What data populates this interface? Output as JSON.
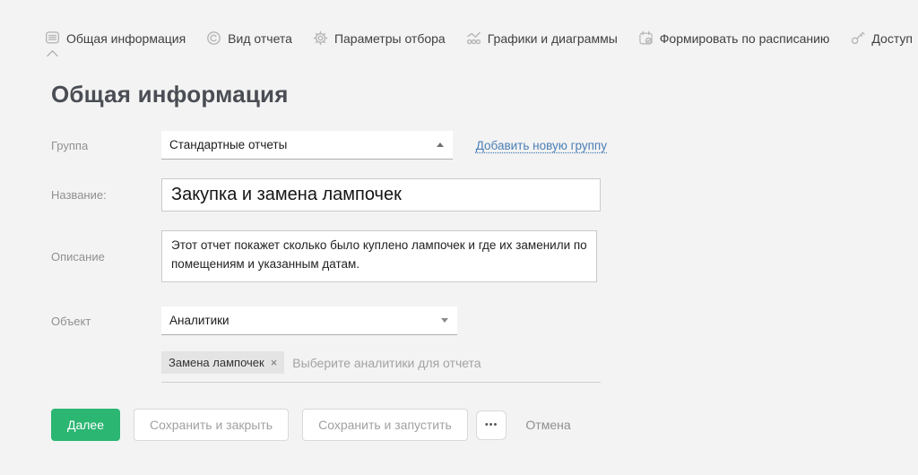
{
  "tabs": [
    {
      "label": "Общая информация",
      "icon": "document-lines-icon",
      "active": true
    },
    {
      "label": "Вид отчета",
      "icon": "report-view-icon",
      "active": false
    },
    {
      "label": "Параметры отбора",
      "icon": "gear-icon",
      "active": false
    },
    {
      "label": "Графики и диаграммы",
      "icon": "chart-icon",
      "active": false
    },
    {
      "label": "Формировать по расписанию",
      "icon": "schedule-calendar-icon",
      "active": false
    },
    {
      "label": "Доступ",
      "icon": "key-icon",
      "active": false
    }
  ],
  "heading": "Общая информация",
  "form": {
    "group": {
      "label": "Группа",
      "value": "Стандартные отчеты",
      "add_link": "Добавить новую группу"
    },
    "name": {
      "label": "Название:",
      "value": "Закупка и замена лампочек"
    },
    "description": {
      "label": "Описание",
      "value": "Этот отчет покажет сколько было куплено лампочек и где их заменили по помещениям и указанным датам."
    },
    "object": {
      "label": "Объект",
      "value": "Аналитики"
    },
    "analytics": {
      "tag": "Замена лампочек",
      "remove_icon": "×",
      "placeholder": "Выберите аналитики для отчета"
    }
  },
  "actions": {
    "next": "Далее",
    "save_close": "Сохранить и закрыть",
    "save_run": "Сохранить и запустить",
    "more": "•••",
    "cancel": "Отмена"
  },
  "colors": {
    "accent_green": "#2bb672",
    "link_blue": "#4a7eb5",
    "page_bg": "#f3f3f3"
  }
}
